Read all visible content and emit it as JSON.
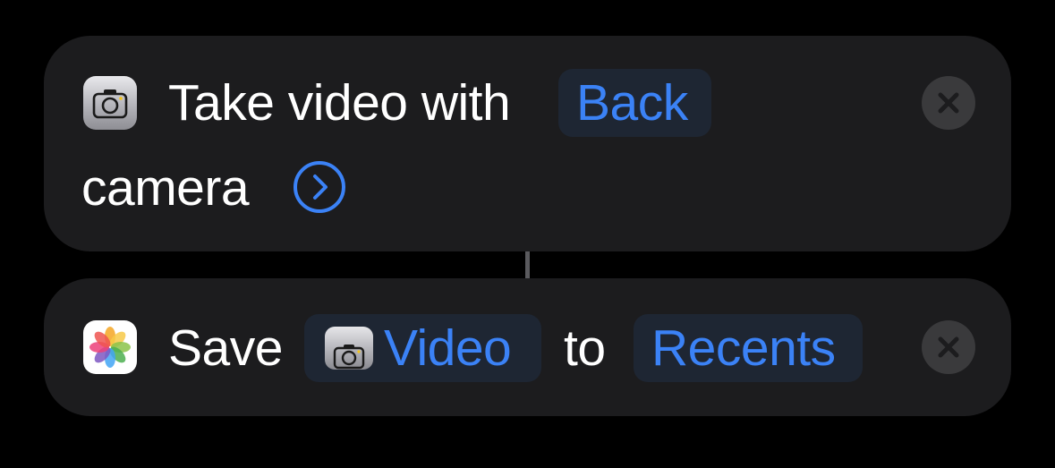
{
  "actions": [
    {
      "app_icon": "camera-app-icon",
      "line1_text": "Take video with",
      "camera_token": "Back",
      "line2_text": "camera",
      "expand_icon": "chevron-right-circle-icon",
      "remove_icon": "close-icon"
    },
    {
      "app_icon": "photos-app-icon",
      "verb_text": "Save",
      "input_token": "Video",
      "input_token_icon": "camera-app-icon",
      "connector_text": "to",
      "album_token": "Recents",
      "remove_icon": "close-icon"
    }
  ],
  "colors": {
    "background": "#000000",
    "card": "#1c1c1e",
    "token_bg": "#1e2633",
    "accent": "#3b82f6",
    "close_button_bg": "#3a3a3c",
    "connector": "#5a5a5e"
  }
}
